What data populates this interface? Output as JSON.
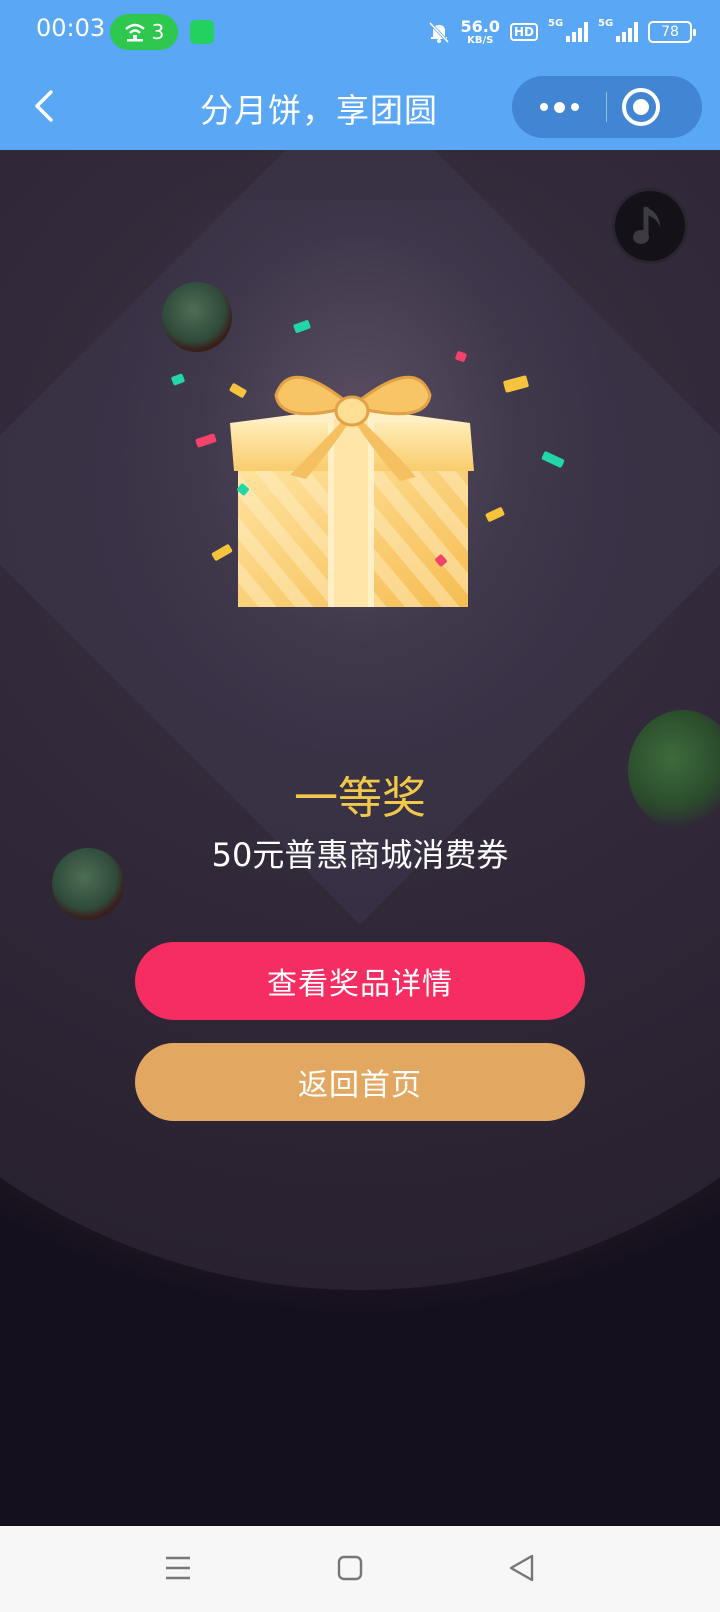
{
  "status_bar": {
    "time": "00:03",
    "hotspot_count": "3",
    "net_speed_value": "56.0",
    "net_speed_unit": "KB/S",
    "hd_label": "HD",
    "signal_1_label": "5G",
    "signal_2_label": "5G",
    "battery_level": "78",
    "icons": [
      "hotspot-icon",
      "app-notification-icon",
      "mute-bell-icon",
      "signal-icon",
      "battery-icon"
    ]
  },
  "nav_bar": {
    "title": "分月饼，享团圆",
    "back_icon": "chevron-left-icon",
    "more_icon": "more-dots-icon",
    "close_icon": "target-close-icon"
  },
  "scene": {
    "music_icon": "music-note-icon",
    "gift_icon": "gift-box-icon"
  },
  "prize": {
    "level": "一等奖",
    "name": "50元普惠商城消费券"
  },
  "buttons": {
    "detail_label": "查看奖品详情",
    "home_label": "返回首页"
  },
  "system_nav": {
    "icons": [
      "menu-icon",
      "home-square-icon",
      "back-triangle-icon"
    ]
  },
  "colors": {
    "nav_bg": "#5aa8f5",
    "scene_bg": "#14101e",
    "prize_level": "#f2c84a",
    "detail_button": "#f52d63",
    "home_button": "#e2a862",
    "system_nav_bg": "#f7f7f7"
  }
}
